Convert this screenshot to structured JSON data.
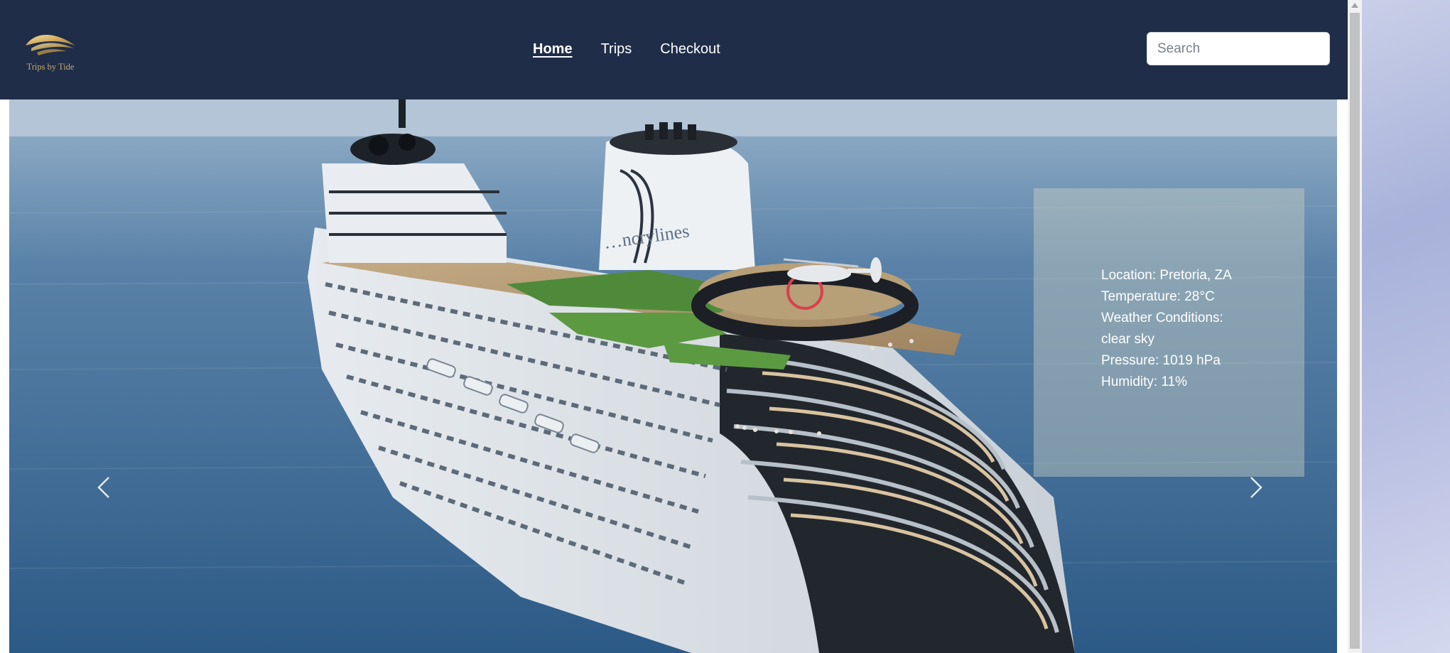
{
  "brand": {
    "name": "Trips by Tide",
    "logo_icon": "golden-sail-logo"
  },
  "nav": {
    "items": [
      "Home",
      "Trips",
      "Checkout"
    ],
    "active": "Home"
  },
  "search": {
    "placeholder": "Search"
  },
  "hero": {
    "ship_hull_text": "…ncrylines",
    "prev_icon": "chevron-left-icon",
    "next_icon": "chevron-right-icon"
  },
  "weather": {
    "location": "Location: Pretoria, ZA",
    "temperature": "Temperature: 28°C",
    "conditions_label": "Weather Conditions:",
    "conditions_value": "clear sky",
    "pressure": "Pressure: 1019 hPa",
    "humidity": "Humidity: 11%"
  },
  "colors": {
    "navbar": "#1f2d48",
    "brand_gold": "#c9a86a",
    "link": "#ffffff"
  }
}
